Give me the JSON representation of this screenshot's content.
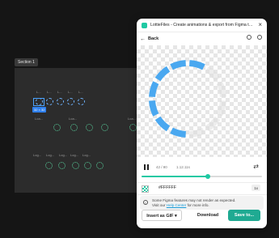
{
  "canvas": {
    "section_label": "Section 1",
    "selection_size": "32 × 32",
    "label_short": "L...",
    "label_loading": "Loa...",
    "label_log": "Log..."
  },
  "panel": {
    "title": "LottieFiles - Create animations & export from Figma to Lot...",
    "back_label": "Back",
    "frame_counter": "42 / 90",
    "time_counter": "1.12.11s",
    "playback_progress": 0.55,
    "color_hex": "#FFFFFF",
    "scale": "1x",
    "notice_text_1": "Some Figma features may not render as expected.",
    "notice_text_2a": "Visit our ",
    "notice_link": "Help Center",
    "notice_text_2b": " for more info.",
    "buttons": {
      "export": "Insert as GIF",
      "export_chevron": "▾",
      "download": "Download",
      "save": "Save to..."
    }
  },
  "icons": {
    "back": "arrow-left-icon",
    "close": "close-icon",
    "loop": "loop-icon",
    "pause": "pause-icon"
  },
  "colors": {
    "accent": "#1fc9a3",
    "save_button": "#1faa92",
    "spinner_active": "#4aa8f0",
    "spinner_faded": "#dcdcdc",
    "canvas_bg": "#151515",
    "frame_bg": "#2c2c2c"
  }
}
